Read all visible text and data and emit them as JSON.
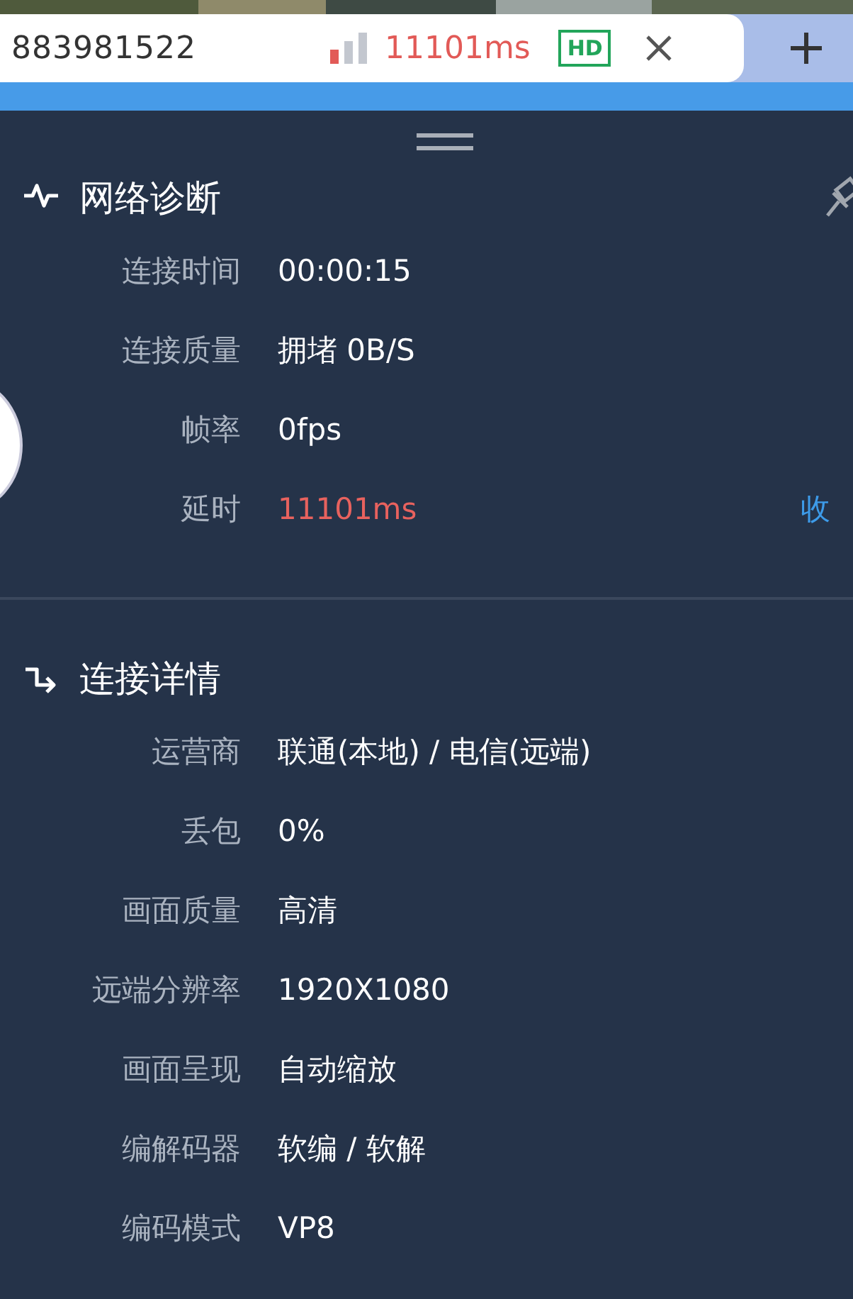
{
  "tab": {
    "title": "883981522",
    "latency": "11101ms",
    "quality_badge": "HD"
  },
  "sections": [
    {
      "kind": "pulse",
      "title": "网络诊断",
      "rows": [
        {
          "label": "连接时间",
          "value": "00:00:15",
          "alert": false
        },
        {
          "label": "连接质量",
          "value": "拥堵 0B/S",
          "alert": false
        },
        {
          "label": "帧率",
          "value": "0fps",
          "alert": false
        },
        {
          "label": "延时",
          "value": "11101ms",
          "alert": true,
          "action": "收"
        }
      ]
    },
    {
      "kind": "turn",
      "title": "连接详情",
      "rows": [
        {
          "label": "运营商",
          "value": "联通(本地) / 电信(远端)",
          "alert": false
        },
        {
          "label": "丢包",
          "value": "0%",
          "alert": false
        },
        {
          "label": "画面质量",
          "value": "高清",
          "alert": false
        },
        {
          "label": "远端分辨率",
          "value": "1920X1080",
          "alert": false
        },
        {
          "label": "画面呈现",
          "value": "自动缩放",
          "alert": false
        },
        {
          "label": "编解码器",
          "value": "软编 / 软解",
          "alert": false
        },
        {
          "label": "编码模式",
          "value": "VP8",
          "alert": false
        }
      ]
    }
  ]
}
